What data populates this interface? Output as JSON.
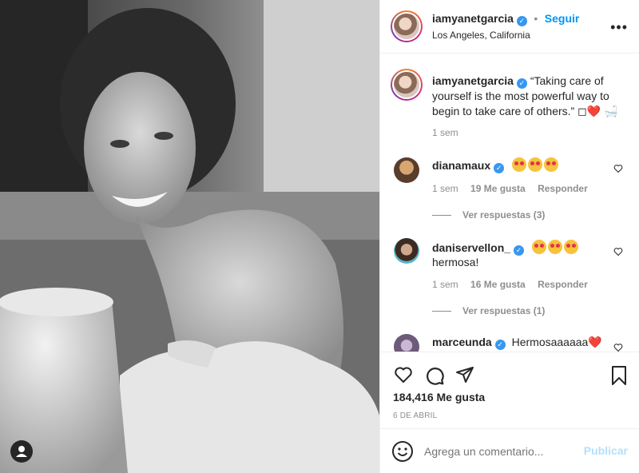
{
  "post": {
    "username": "iamyanetgarcia",
    "follow_label": "Seguir",
    "location": "Los Angeles, California",
    "caption": "“Taking care of yourself is the most powerful way to begin to take care of others.” ◻❤️ 🛁",
    "caption_time": "1 sem",
    "likes": "184,416 Me gusta",
    "date": "6 DE ABRIL"
  },
  "comments": [
    {
      "user": "dianamaux",
      "text": "",
      "time": "1 sem",
      "likes": "19 Me gusta",
      "reply": "Responder",
      "view_replies": "Ver respuestas (3)"
    },
    {
      "user": "daniservellon_",
      "text": "hermosa!",
      "time": "1 sem",
      "likes": "16 Me gusta",
      "reply": "Responder",
      "view_replies": "Ver respuestas (1)"
    },
    {
      "user": "marceunda",
      "text": "Hermosaaaaaa❤️"
    }
  ],
  "compose": {
    "placeholder": "Agrega un comentario...",
    "publish_label": "Publicar"
  },
  "colors": {
    "verified": "#3897f0",
    "link": "#0095f6",
    "publish_disabled": "#b2dffc"
  }
}
